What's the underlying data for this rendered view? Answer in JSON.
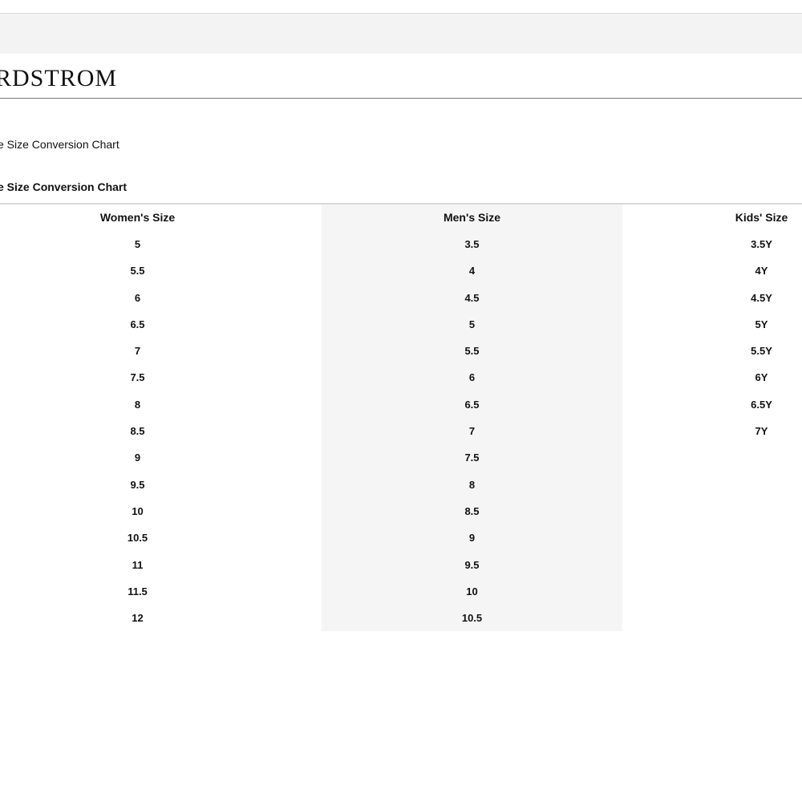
{
  "brand": {
    "logo_text": "RDSTROM"
  },
  "breadcrumb": {
    "text": "e Size Conversion Chart"
  },
  "section": {
    "title": "e Size Conversion Chart"
  },
  "table": {
    "columns": [
      {
        "header": "Women's Size",
        "values": [
          "5",
          "5.5",
          "6",
          "6.5",
          "7",
          "7.5",
          "8",
          "8.5",
          "9",
          "9.5",
          "10",
          "10.5",
          "11",
          "11.5",
          "12"
        ]
      },
      {
        "header": "Men's Size",
        "values": [
          "3.5",
          "4",
          "4.5",
          "5",
          "5.5",
          "6",
          "6.5",
          "7",
          "7.5",
          "8",
          "8.5",
          "9",
          "9.5",
          "10",
          "10.5"
        ]
      },
      {
        "header": "Kids' Size",
        "values": [
          "3.5Y",
          "4Y",
          "4.5Y",
          "5Y",
          "5.5Y",
          "6Y",
          "6.5Y",
          "7Y"
        ]
      }
    ]
  },
  "colors": {
    "top_bar": "#f3f3f4",
    "column_highlight": "#f5f5f5",
    "divider": "#7a7a7a"
  }
}
